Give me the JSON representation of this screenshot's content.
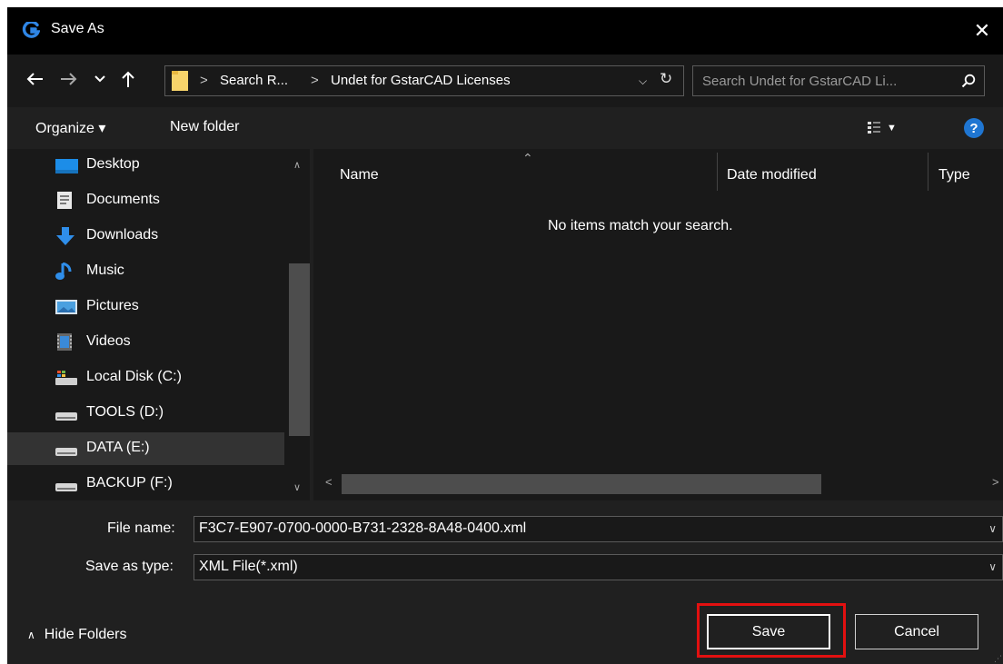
{
  "window": {
    "title": "Save As"
  },
  "address_bar": {
    "crumbs": [
      "Search R...",
      "Undet for GstarCAD Licenses"
    ],
    "separator": ">"
  },
  "search": {
    "placeholder": "Search Undet for GstarCAD Li..."
  },
  "toolbar": {
    "organize_label": "Organize ▾",
    "new_folder_label": "New folder"
  },
  "nav_pane": {
    "items": [
      {
        "label": "Desktop",
        "icon": "desktop-icon"
      },
      {
        "label": "Documents",
        "icon": "documents-icon"
      },
      {
        "label": "Downloads",
        "icon": "downloads-icon"
      },
      {
        "label": "Music",
        "icon": "music-icon"
      },
      {
        "label": "Pictures",
        "icon": "pictures-icon"
      },
      {
        "label": "Videos",
        "icon": "videos-icon"
      },
      {
        "label": "Local Disk (C:)",
        "icon": "system-drive-icon"
      },
      {
        "label": "TOOLS (D:)",
        "icon": "drive-icon"
      },
      {
        "label": "DATA (E:)",
        "icon": "drive-icon",
        "selected": true
      },
      {
        "label": "BACKUP (F:)",
        "icon": "drive-icon"
      }
    ]
  },
  "file_list": {
    "columns": [
      "Name",
      "Date modified",
      "Type"
    ],
    "empty_message": "No items match your search."
  },
  "form": {
    "file_name_label": "File name:",
    "file_name_value": "F3C7-E907-0700-0000-B731-2328-8A48-0400.xml",
    "save_type_label": "Save as type:",
    "save_type_value": "XML File(*.xml)"
  },
  "footer": {
    "hide_folders_label": "Hide Folders",
    "save_label": "Save",
    "cancel_label": "Cancel"
  },
  "colors": {
    "title_bar": "#000000",
    "background": "#202020",
    "pane": "#191919",
    "accent": "#1f76d2",
    "folder": "#f6d36a",
    "highlight": "#e21010"
  }
}
